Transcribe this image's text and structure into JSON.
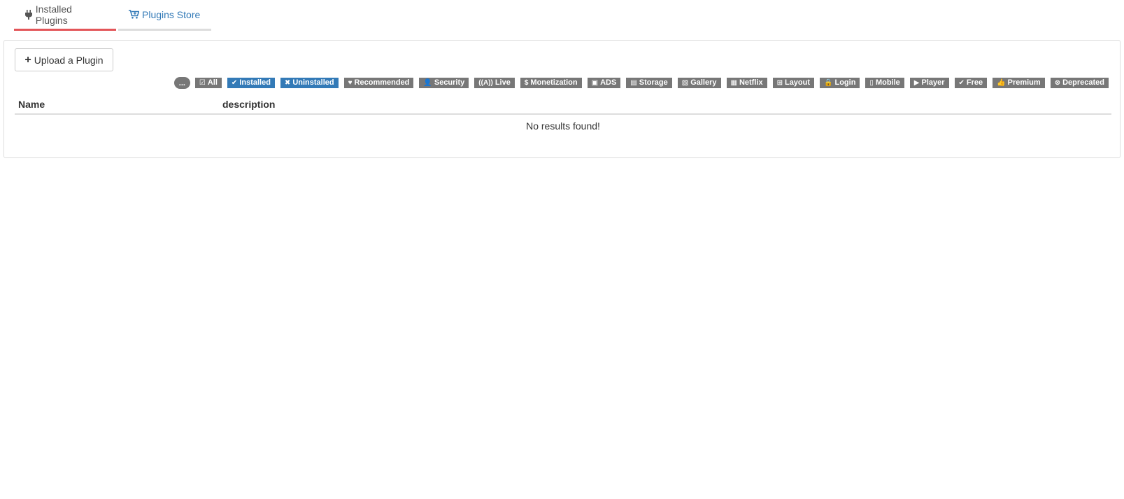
{
  "tabs": [
    {
      "label": "Installed Plugins",
      "icon": "plug-icon",
      "active": true
    },
    {
      "label": "Plugins Store",
      "icon": "cart-icon",
      "active": false
    }
  ],
  "upload_button": {
    "label": "Upload a Plugin",
    "icon": "plus-icon"
  },
  "filters": {
    "more_label": "...",
    "chips": [
      {
        "label": "All",
        "icon": "check-square-icon",
        "glyph": "☑",
        "active": false
      },
      {
        "label": "Installed",
        "icon": "check-icon",
        "glyph": "✔",
        "active": true
      },
      {
        "label": "Uninstalled",
        "icon": "times-icon",
        "glyph": "✖",
        "active": true
      },
      {
        "label": "Recommended",
        "icon": "heart-icon",
        "glyph": "♥",
        "active": false
      },
      {
        "label": "Security",
        "icon": "user-lock-icon",
        "glyph": "👤",
        "active": false
      },
      {
        "label": "Live",
        "icon": "broadcast-icon",
        "glyph": "((A))",
        "active": false
      },
      {
        "label": "Monetization",
        "icon": "dollar-icon",
        "glyph": "$",
        "active": false
      },
      {
        "label": "ADS",
        "icon": "ad-icon",
        "glyph": "▣",
        "active": false
      },
      {
        "label": "Storage",
        "icon": "archive-icon",
        "glyph": "▤",
        "active": false
      },
      {
        "label": "Gallery",
        "icon": "images-icon",
        "glyph": "▧",
        "active": false
      },
      {
        "label": "Netflix",
        "icon": "film-icon",
        "glyph": "▦",
        "active": false
      },
      {
        "label": "Layout",
        "icon": "sitemap-icon",
        "glyph": "⊞",
        "active": false
      },
      {
        "label": "Login",
        "icon": "lock-icon",
        "glyph": "🔒",
        "active": false
      },
      {
        "label": "Mobile",
        "icon": "mobile-icon",
        "glyph": "▯",
        "active": false
      },
      {
        "label": "Player",
        "icon": "play-circle-icon",
        "glyph": "▶",
        "active": false
      },
      {
        "label": "Free",
        "icon": "check-icon",
        "glyph": "✔",
        "active": false
      },
      {
        "label": "Premium",
        "icon": "thumbs-up-icon",
        "glyph": "👍",
        "active": false
      },
      {
        "label": "Deprecated",
        "icon": "times-circle-icon",
        "glyph": "⊗",
        "active": false
      }
    ]
  },
  "table": {
    "columns": [
      "Name",
      "description"
    ],
    "empty_message": "No results found!"
  },
  "colors": {
    "active_tab_border": "#e35559",
    "inactive_tab_border": "#dddddd",
    "link": "#337ab7",
    "chip_default": "#777777",
    "chip_active": "#337ab7"
  }
}
